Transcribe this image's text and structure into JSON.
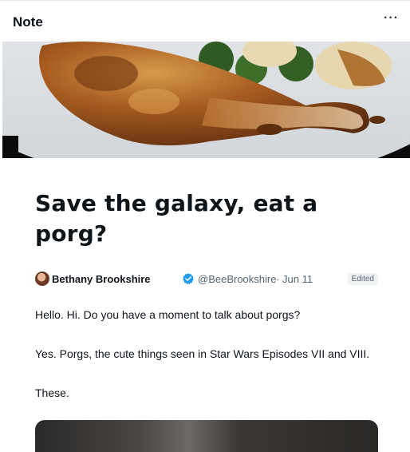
{
  "header": {
    "title": "Note",
    "more_label": "···"
  },
  "hero": {
    "icon": "roast-chicken-photo"
  },
  "article": {
    "title": "Save the galaxy, eat a porg?",
    "author": {
      "name": "Bethany Brookshire",
      "handle": "@BeeBrookshire",
      "separator": "·",
      "date": "Jun 11",
      "verified_icon": "verified-badge-icon",
      "badge": "Edited"
    },
    "paragraphs": [
      "Hello. Hi. Do you have a moment to talk about porgs?",
      "Yes. Porgs, the cute things seen in Star Wars Episodes VII and VIII.",
      "These."
    ]
  },
  "colors": {
    "verified": "#1d9bf0",
    "text": "#0f1419",
    "muted": "#536471"
  }
}
